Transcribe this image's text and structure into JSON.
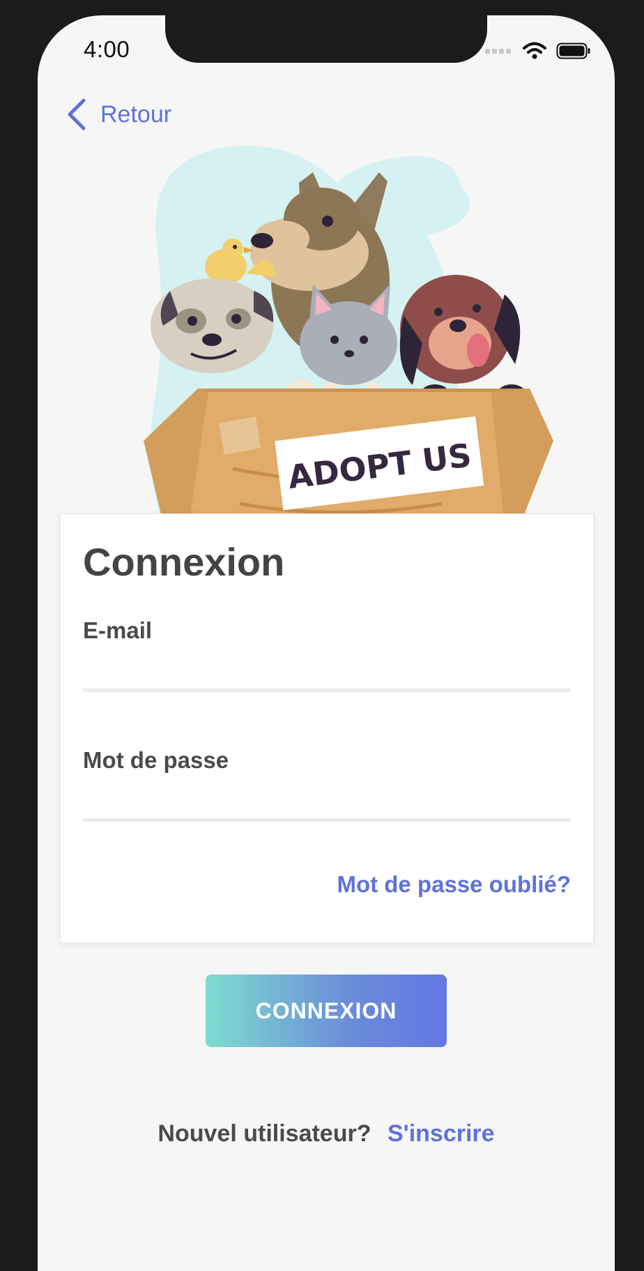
{
  "status_bar": {
    "time": "4:00",
    "icons": [
      "signal-icon",
      "wifi-icon",
      "battery-icon"
    ]
  },
  "nav": {
    "back_label": "Retour",
    "back_icon": "chevron-left-icon"
  },
  "hero": {
    "illustration": "pets-in-box-illustration",
    "sign_text": "ADOPT US"
  },
  "login_card": {
    "title": "Connexion",
    "email_label": "E-mail",
    "email_value": "",
    "password_label": "Mot de passe",
    "password_value": "",
    "forgot_link": "Mot de passe oublié?"
  },
  "login_button": {
    "label": "CONNEXION"
  },
  "signup": {
    "prompt": "Nouvel utilisateur?",
    "link": "S'inscrire"
  },
  "colors": {
    "accent": "#5f72d8",
    "background": "#f6f6f6",
    "button_gradient_start": "#7fdccf",
    "button_gradient_end": "#6377e2",
    "text": "#4a4a4a"
  }
}
